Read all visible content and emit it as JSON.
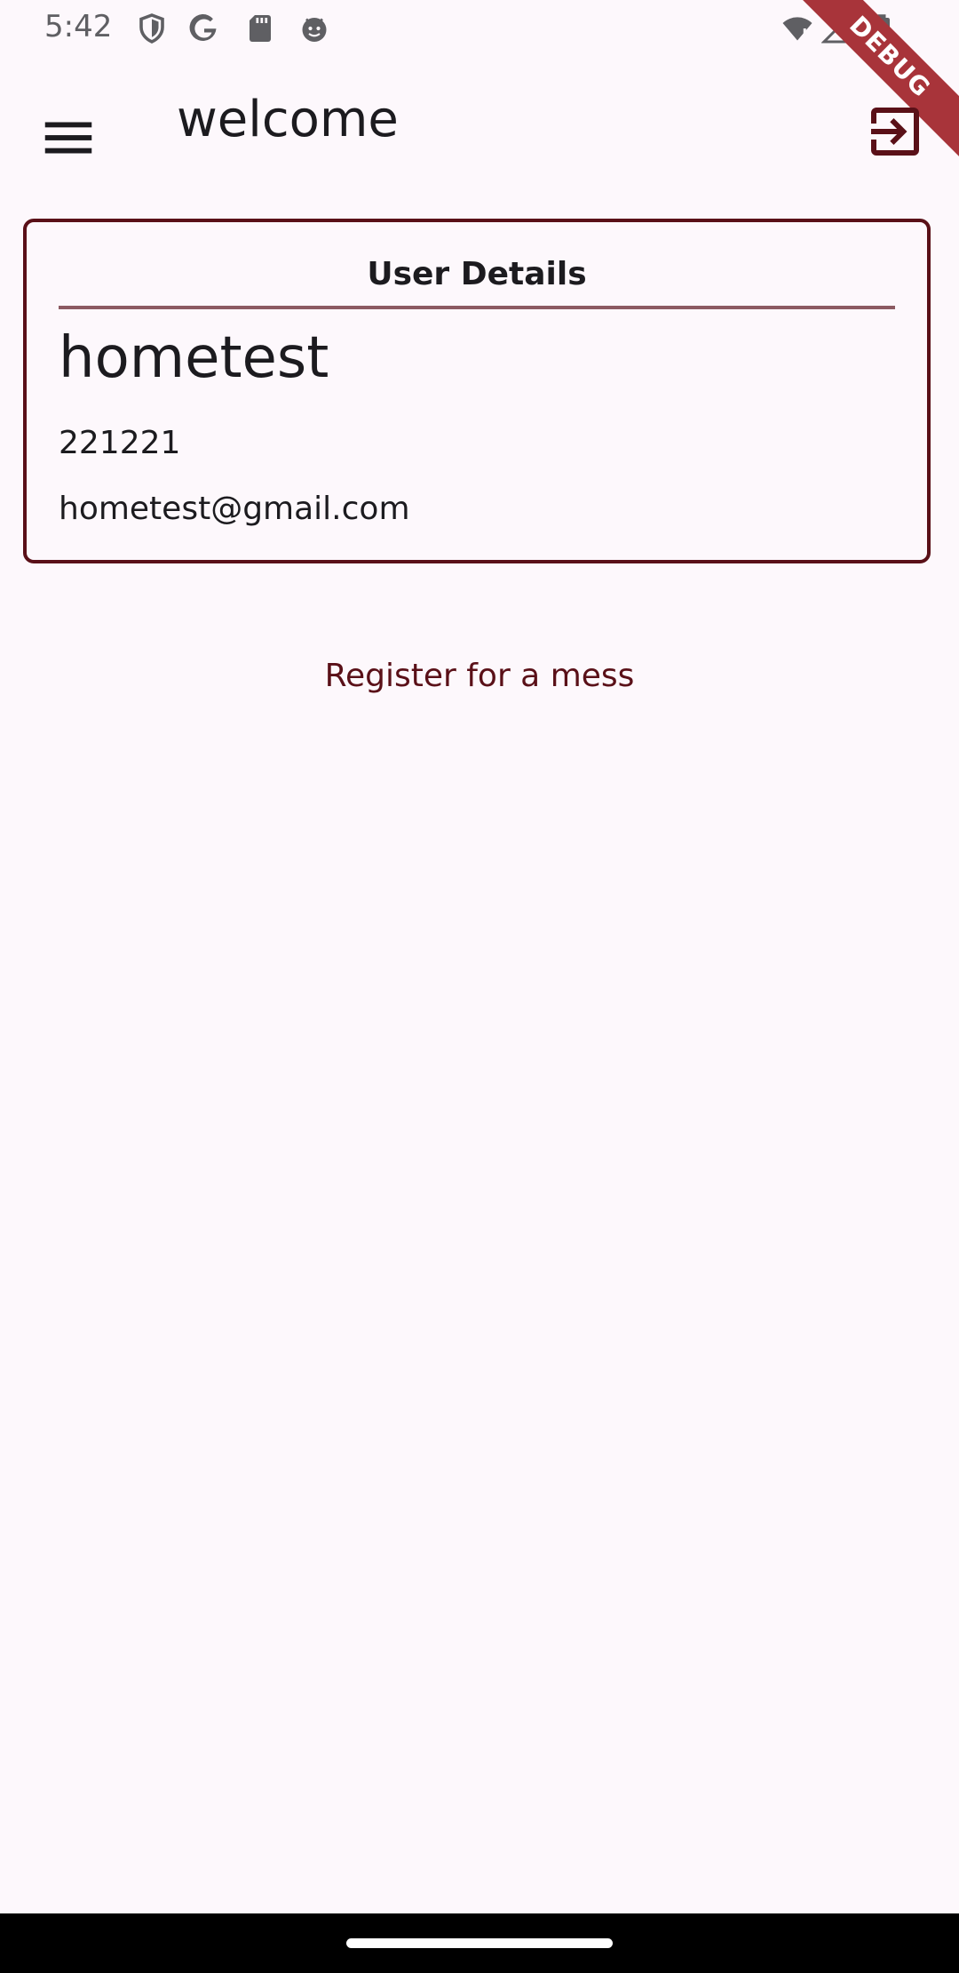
{
  "status_bar": {
    "time": "5:42",
    "left_icons": [
      "shield-icon",
      "google-icon",
      "sd-card-icon",
      "android-face-icon"
    ],
    "right_icons": [
      "wifi-alert-icon",
      "signal-icon",
      "battery-icon"
    ]
  },
  "debug_banner": "DEBUG",
  "app_bar": {
    "menu_icon": "hamburger-menu-icon",
    "title": "welcome",
    "logout_icon": "logout-icon"
  },
  "user_card": {
    "heading": "User Details",
    "name": "hometest",
    "id": "221221",
    "email": "hometest@gmail.com"
  },
  "actions": {
    "register_label": "Register for a mess"
  },
  "colors": {
    "background": "#fdf8fc",
    "accent": "#5a1018",
    "divider": "#8c5a62",
    "debug": "#a8343a"
  }
}
